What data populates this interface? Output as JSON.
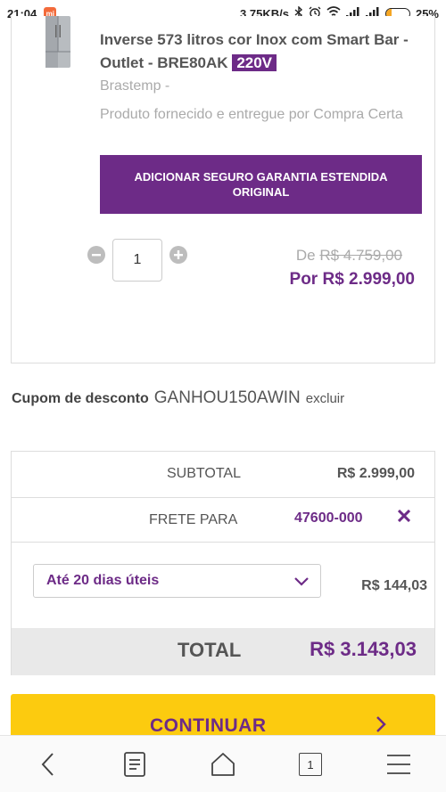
{
  "status_bar": {
    "time": "21:04",
    "network_speed": "3,75KB/s",
    "battery_percent": "25%",
    "battery_level": 0.25
  },
  "product": {
    "title": "Inverse 573 litros cor Inox com Smart Bar - Outlet - BRE80AK",
    "voltage": "220V",
    "brand": "Brastemp -",
    "supplier_note": "Produto fornecido e entregue por Compra Certa",
    "warranty_button": "ADICIONAR SEGURO GARANTIA ESTENDIDA ORIGINAL",
    "quantity": "1",
    "price_old_prefix": "De",
    "price_old": "R$ 4.759,00",
    "price_new": "Por R$ 2.999,00"
  },
  "coupon": {
    "label": "Cupom de desconto",
    "code": "GANHOU150AWIN",
    "remove_label": "excluir"
  },
  "summary": {
    "subtotal_label": "SUBTOTAL",
    "subtotal_value": "R$ 2.999,00",
    "frete_label": "FRETE PARA",
    "frete_cep": "47600-000",
    "shipping_option": "Até 20 dias úteis",
    "shipping_price": "R$ 144,03",
    "total_label": "TOTAL",
    "total_value": "R$ 3.143,03"
  },
  "continue_label": "CONTINUAR",
  "navbar": {
    "tab_count": "1"
  },
  "colors": {
    "brand_purple": "#6d2b87",
    "cta_yellow": "#fccb0f"
  },
  "icons": [
    "signal-icon",
    "wifi-icon",
    "bluetooth-icon",
    "alarm-icon",
    "battery-icon",
    "minus-icon",
    "plus-icon",
    "close-icon",
    "chevron-down-icon",
    "chevron-right-icon",
    "back-icon",
    "bookmarks-icon",
    "home-icon",
    "tabs-icon",
    "menu-icon"
  ]
}
